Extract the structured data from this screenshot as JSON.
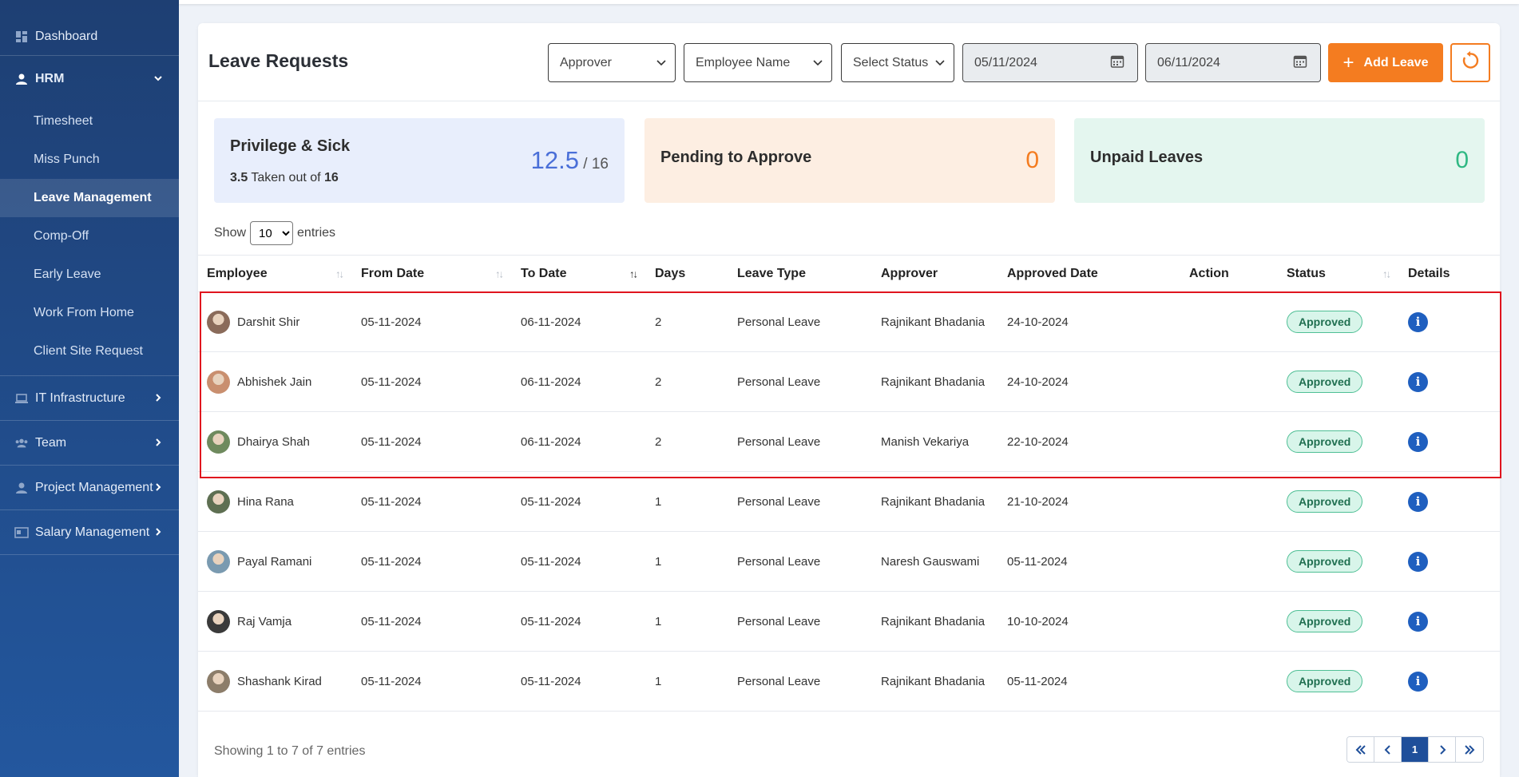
{
  "sidebar": {
    "dashboard": "Dashboard",
    "hrm": "HRM",
    "hrm_items": [
      "Timesheet",
      "Miss Punch",
      "Leave Management",
      "Comp-Off",
      "Early Leave",
      "Work From Home",
      "Client Site Request"
    ],
    "active_item": "Leave Management",
    "it": "IT Infrastructure",
    "team": "Team",
    "project": "Project Management",
    "salary": "Salary Management"
  },
  "header": {
    "title": "Leave Requests",
    "approver_placeholder": "Approver",
    "employee_placeholder": "Employee Name",
    "status_placeholder": "Select Status",
    "from_date": "05/11/2024",
    "to_date": "06/11/2024",
    "add_leave": "Add Leave"
  },
  "stats": {
    "privilege": {
      "title": "Privilege & Sick",
      "taken": "3.5",
      "taken_text": " Taken out of ",
      "total": "16",
      "remaining": "12.5",
      "total_display": " / 16"
    },
    "pending": {
      "title": "Pending to Approve",
      "value": "0"
    },
    "unpaid": {
      "title": "Unpaid Leaves",
      "value": "0"
    }
  },
  "entries": {
    "show": "Show",
    "value": "10",
    "suffix": "entries"
  },
  "table": {
    "columns": [
      "Employee",
      "From Date",
      "To Date",
      "Days",
      "Leave Type",
      "Approver",
      "Approved Date",
      "Action",
      "Status",
      "Details"
    ],
    "rows": [
      {
        "employee": "Darshit Shir",
        "from": "05-11-2024",
        "to": "06-11-2024",
        "days": "2",
        "type": "Personal Leave",
        "approver": "Rajnikant Bhadania",
        "approved": "24-10-2024",
        "status": "Approved"
      },
      {
        "employee": "Abhishek Jain",
        "from": "05-11-2024",
        "to": "06-11-2024",
        "days": "2",
        "type": "Personal Leave",
        "approver": "Rajnikant Bhadania",
        "approved": "24-10-2024",
        "status": "Approved"
      },
      {
        "employee": "Dhairya Shah",
        "from": "05-11-2024",
        "to": "06-11-2024",
        "days": "2",
        "type": "Personal Leave",
        "approver": "Manish Vekariya",
        "approved": "22-10-2024",
        "status": "Approved"
      },
      {
        "employee": "Hina Rana",
        "from": "05-11-2024",
        "to": "05-11-2024",
        "days": "1",
        "type": "Personal Leave",
        "approver": "Rajnikant Bhadania",
        "approved": "21-10-2024",
        "status": "Approved"
      },
      {
        "employee": "Payal Ramani",
        "from": "05-11-2024",
        "to": "05-11-2024",
        "days": "1",
        "type": "Personal Leave",
        "approver": "Naresh Gauswami",
        "approved": "05-11-2024",
        "status": "Approved"
      },
      {
        "employee": "Raj Vamja",
        "from": "05-11-2024",
        "to": "05-11-2024",
        "days": "1",
        "type": "Personal Leave",
        "approver": "Rajnikant Bhadania",
        "approved": "10-10-2024",
        "status": "Approved"
      },
      {
        "employee": "Shashank Kirad",
        "from": "05-11-2024",
        "to": "05-11-2024",
        "days": "1",
        "type": "Personal Leave",
        "approver": "Rajnikant Bhadania",
        "approved": "05-11-2024",
        "status": "Approved"
      }
    ]
  },
  "footer": {
    "info": "Showing 1 to 7 of 7 entries",
    "current_page": "1"
  },
  "colors": {
    "accent": "#f47c20",
    "sidebar": "#1e3f73",
    "approved_bg": "#d8f5ea",
    "info": "#1f5fbf"
  },
  "icons": {
    "dashboard": "grid-icon",
    "hrm": "user-icon",
    "it": "laptop-icon",
    "team": "users-icon",
    "project": "user-icon",
    "salary": "card-icon"
  }
}
